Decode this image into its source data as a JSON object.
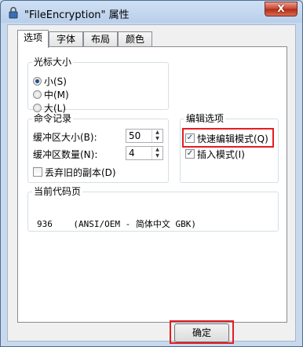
{
  "window": {
    "title": "\"FileEncryption\" 属性",
    "close_label": "X"
  },
  "tabs": [
    "选项",
    "字体",
    "布局",
    "颜色"
  ],
  "cursor_size": {
    "legend": "光标大小",
    "options": [
      "小(S)",
      "中(M)",
      "大(L)"
    ],
    "selected": "小(S)"
  },
  "command_history": {
    "legend": "命令记录",
    "buffer_size_label": "缓冲区大小(B):",
    "buffer_size_value": "50",
    "buffer_count_label": "缓冲区数量(N):",
    "buffer_count_value": "4",
    "discard_label": "丢弃旧的副本(D)",
    "discard_checked": false
  },
  "edit_options": {
    "legend": "编辑选项",
    "quick_edit_label": "快速编辑模式(Q)",
    "quick_edit_checked": true,
    "insert_label": "插入模式(I)",
    "insert_checked": true
  },
  "codepage": {
    "legend": "当前代码页",
    "value": "936    (ANSI/OEM - 简体中文 GBK)"
  },
  "buttons": {
    "ok_label": "确定"
  },
  "colors": {
    "highlight": "#e51c23"
  }
}
